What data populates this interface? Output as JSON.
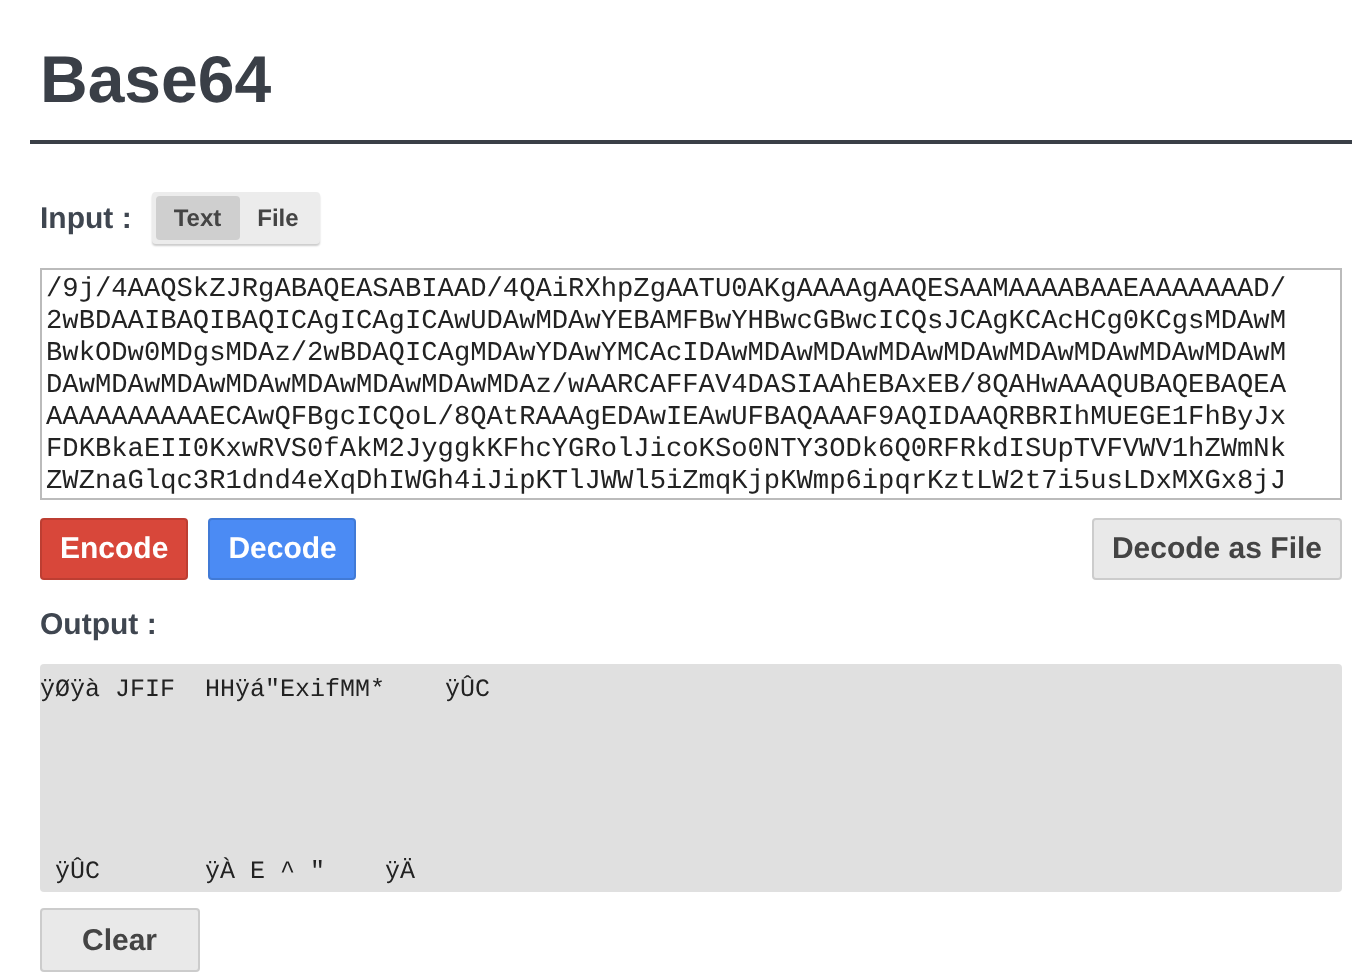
{
  "title": "Base64",
  "input": {
    "label": "Input :",
    "tabs": [
      {
        "label": "Text",
        "selected": true
      },
      {
        "label": "File",
        "selected": false
      }
    ],
    "lines": [
      "/9j/4AAQSkZJRgABAQEASABIAAD/4QAiRXhpZgAATU0AKgAAAAgAAQESAAMAAAABAAEAAAAAAAD/",
      "2wBDAAIBAQIBAQICAgICAgICAwUDAwMDAwYEBAMFBwYHBwcGBwcICQsJCAgKCAcHCg0KCgsMDAwM",
      "BwkODw0MDgsMDAz/2wBDAQICAgMDAwYDAwYMCAcIDAwMDAwMDAwMDAwMDAwMDAwMDAwMDAwMDAwM",
      "DAwMDAwMDAwMDAwMDAwMDAwMDAwMDAz/wAARCAFFAV4DASIAAhEBAxEB/8QAHwAAAQUBAQEBAQEA",
      "AAAAAAAAAAECAwQFBgcICQoL/8QAtRAAAgEDAwIEAwUFBAQAAAF9AQIDAAQRBRIhMUEGE1FhByJx",
      "FDKBkaEII0KxwRVS0fAkM2JyggkKFhcYGRolJicoKSo0NTY3ODk6Q0RFRkdISUpTVFVWV1hZWmNk",
      "ZWZnaGlqc3R1dnd4eXqDhIWGh4iJipKTlJWWl5iZmqKjpKWmp6ipqrKztLW2t7i5usLDxMXGx8jJ"
    ]
  },
  "actions": [
    {
      "label": "Encode",
      "kind": "encode"
    },
    {
      "label": "Decode",
      "kind": "decode"
    },
    {
      "label": "Decode as File",
      "kind": "file"
    }
  ],
  "output": {
    "label": "Output :",
    "lines": [
      "ÿØÿà JFIF  HHÿá\"ExifMM*    ÿÛC",
      " ÿÛC       ÿÀ E ^ \"    ÿÄ"
    ]
  },
  "clear": "Clear"
}
